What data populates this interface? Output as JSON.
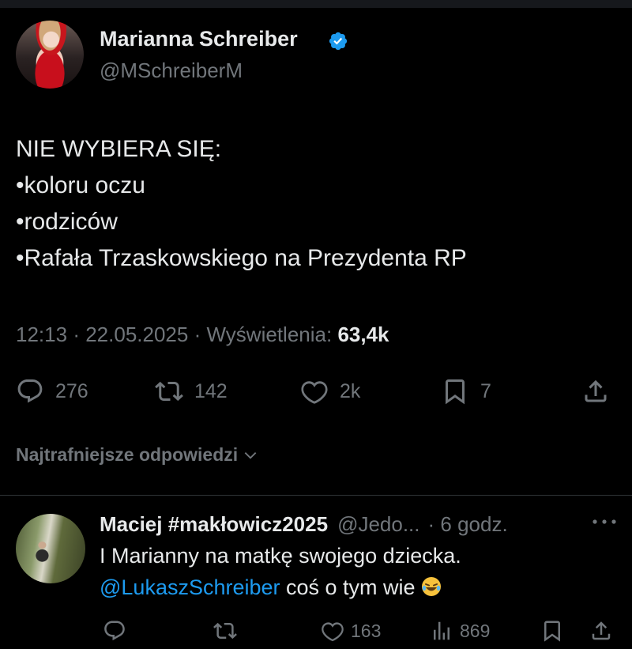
{
  "tweet": {
    "author": {
      "name": "Marianna Schreiber",
      "handle": "@MSchreiberM",
      "verified": true
    },
    "text_lines": [
      "NIE WYBIERA SIĘ:",
      "•koloru oczu",
      "•rodziców",
      "•Rafała Trzaskowskiego na Prezydenta RP"
    ],
    "meta": {
      "time": "12:13",
      "date": "22.05.2025",
      "views_label": "Wyświetlenia:",
      "views": "63,4k",
      "separator": "·"
    },
    "actions": {
      "replies": "276",
      "retweets": "142",
      "likes": "2k",
      "bookmarks": "7"
    }
  },
  "replies_sort_label": "Najtrafniejsze odpowiedzi",
  "reply": {
    "name": "Maciej #makłowicz2025",
    "handle": "@Jedo...",
    "time": "· 6 godz.",
    "line1": "I Marianny na matkę swojego dziecka.",
    "mention": "@LukaszSchreiber",
    "line2_rest": " coś o tym wie",
    "actions": {
      "likes": "163",
      "views": "869"
    }
  },
  "colors": {
    "background": "#000000",
    "text": "#e7e9ea",
    "muted": "#71767b",
    "accent": "#1d9bf0",
    "divider": "#2f3336"
  },
  "icons": [
    "verified-badge-icon",
    "reply-icon",
    "retweet-icon",
    "like-icon",
    "bookmark-icon",
    "share-icon",
    "chevron-down-icon",
    "more-icon",
    "views-icon",
    "laughing-emoji-icon"
  ]
}
